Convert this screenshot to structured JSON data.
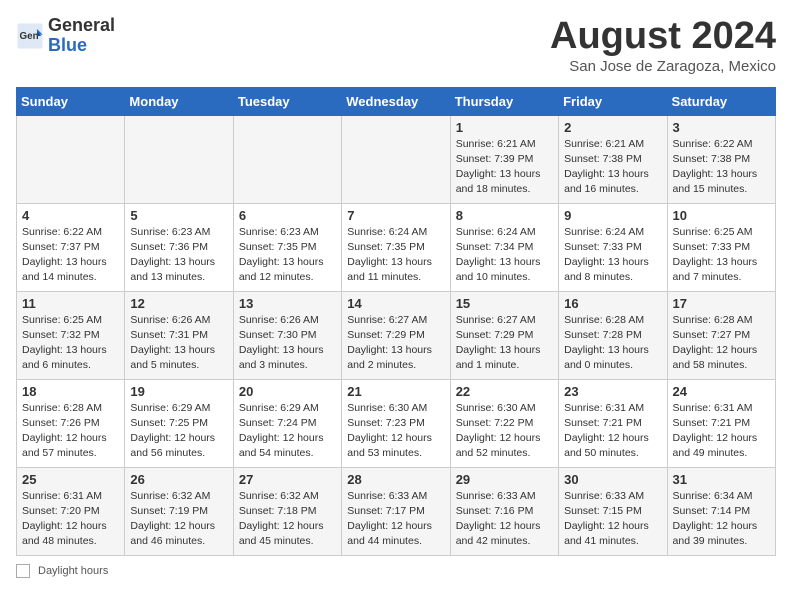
{
  "header": {
    "logo_general": "General",
    "logo_blue": "Blue",
    "month_title": "August 2024",
    "location": "San Jose de Zaragoza, Mexico"
  },
  "days_of_week": [
    "Sunday",
    "Monday",
    "Tuesday",
    "Wednesday",
    "Thursday",
    "Friday",
    "Saturday"
  ],
  "weeks": [
    [
      {
        "day": "",
        "info": ""
      },
      {
        "day": "",
        "info": ""
      },
      {
        "day": "",
        "info": ""
      },
      {
        "day": "",
        "info": ""
      },
      {
        "day": "1",
        "info": "Sunrise: 6:21 AM\nSunset: 7:39 PM\nDaylight: 13 hours\nand 18 minutes."
      },
      {
        "day": "2",
        "info": "Sunrise: 6:21 AM\nSunset: 7:38 PM\nDaylight: 13 hours\nand 16 minutes."
      },
      {
        "day": "3",
        "info": "Sunrise: 6:22 AM\nSunset: 7:38 PM\nDaylight: 13 hours\nand 15 minutes."
      }
    ],
    [
      {
        "day": "4",
        "info": "Sunrise: 6:22 AM\nSunset: 7:37 PM\nDaylight: 13 hours\nand 14 minutes."
      },
      {
        "day": "5",
        "info": "Sunrise: 6:23 AM\nSunset: 7:36 PM\nDaylight: 13 hours\nand 13 minutes."
      },
      {
        "day": "6",
        "info": "Sunrise: 6:23 AM\nSunset: 7:35 PM\nDaylight: 13 hours\nand 12 minutes."
      },
      {
        "day": "7",
        "info": "Sunrise: 6:24 AM\nSunset: 7:35 PM\nDaylight: 13 hours\nand 11 minutes."
      },
      {
        "day": "8",
        "info": "Sunrise: 6:24 AM\nSunset: 7:34 PM\nDaylight: 13 hours\nand 10 minutes."
      },
      {
        "day": "9",
        "info": "Sunrise: 6:24 AM\nSunset: 7:33 PM\nDaylight: 13 hours\nand 8 minutes."
      },
      {
        "day": "10",
        "info": "Sunrise: 6:25 AM\nSunset: 7:33 PM\nDaylight: 13 hours\nand 7 minutes."
      }
    ],
    [
      {
        "day": "11",
        "info": "Sunrise: 6:25 AM\nSunset: 7:32 PM\nDaylight: 13 hours\nand 6 minutes."
      },
      {
        "day": "12",
        "info": "Sunrise: 6:26 AM\nSunset: 7:31 PM\nDaylight: 13 hours\nand 5 minutes."
      },
      {
        "day": "13",
        "info": "Sunrise: 6:26 AM\nSunset: 7:30 PM\nDaylight: 13 hours\nand 3 minutes."
      },
      {
        "day": "14",
        "info": "Sunrise: 6:27 AM\nSunset: 7:29 PM\nDaylight: 13 hours\nand 2 minutes."
      },
      {
        "day": "15",
        "info": "Sunrise: 6:27 AM\nSunset: 7:29 PM\nDaylight: 13 hours\nand 1 minute."
      },
      {
        "day": "16",
        "info": "Sunrise: 6:28 AM\nSunset: 7:28 PM\nDaylight: 13 hours\nand 0 minutes."
      },
      {
        "day": "17",
        "info": "Sunrise: 6:28 AM\nSunset: 7:27 PM\nDaylight: 12 hours\nand 58 minutes."
      }
    ],
    [
      {
        "day": "18",
        "info": "Sunrise: 6:28 AM\nSunset: 7:26 PM\nDaylight: 12 hours\nand 57 minutes."
      },
      {
        "day": "19",
        "info": "Sunrise: 6:29 AM\nSunset: 7:25 PM\nDaylight: 12 hours\nand 56 minutes."
      },
      {
        "day": "20",
        "info": "Sunrise: 6:29 AM\nSunset: 7:24 PM\nDaylight: 12 hours\nand 54 minutes."
      },
      {
        "day": "21",
        "info": "Sunrise: 6:30 AM\nSunset: 7:23 PM\nDaylight: 12 hours\nand 53 minutes."
      },
      {
        "day": "22",
        "info": "Sunrise: 6:30 AM\nSunset: 7:22 PM\nDaylight: 12 hours\nand 52 minutes."
      },
      {
        "day": "23",
        "info": "Sunrise: 6:31 AM\nSunset: 7:21 PM\nDaylight: 12 hours\nand 50 minutes."
      },
      {
        "day": "24",
        "info": "Sunrise: 6:31 AM\nSunset: 7:21 PM\nDaylight: 12 hours\nand 49 minutes."
      }
    ],
    [
      {
        "day": "25",
        "info": "Sunrise: 6:31 AM\nSunset: 7:20 PM\nDaylight: 12 hours\nand 48 minutes."
      },
      {
        "day": "26",
        "info": "Sunrise: 6:32 AM\nSunset: 7:19 PM\nDaylight: 12 hours\nand 46 minutes."
      },
      {
        "day": "27",
        "info": "Sunrise: 6:32 AM\nSunset: 7:18 PM\nDaylight: 12 hours\nand 45 minutes."
      },
      {
        "day": "28",
        "info": "Sunrise: 6:33 AM\nSunset: 7:17 PM\nDaylight: 12 hours\nand 44 minutes."
      },
      {
        "day": "29",
        "info": "Sunrise: 6:33 AM\nSunset: 7:16 PM\nDaylight: 12 hours\nand 42 minutes."
      },
      {
        "day": "30",
        "info": "Sunrise: 6:33 AM\nSunset: 7:15 PM\nDaylight: 12 hours\nand 41 minutes."
      },
      {
        "day": "31",
        "info": "Sunrise: 6:34 AM\nSunset: 7:14 PM\nDaylight: 12 hours\nand 39 minutes."
      }
    ]
  ],
  "legend": {
    "label": "Daylight hours"
  }
}
